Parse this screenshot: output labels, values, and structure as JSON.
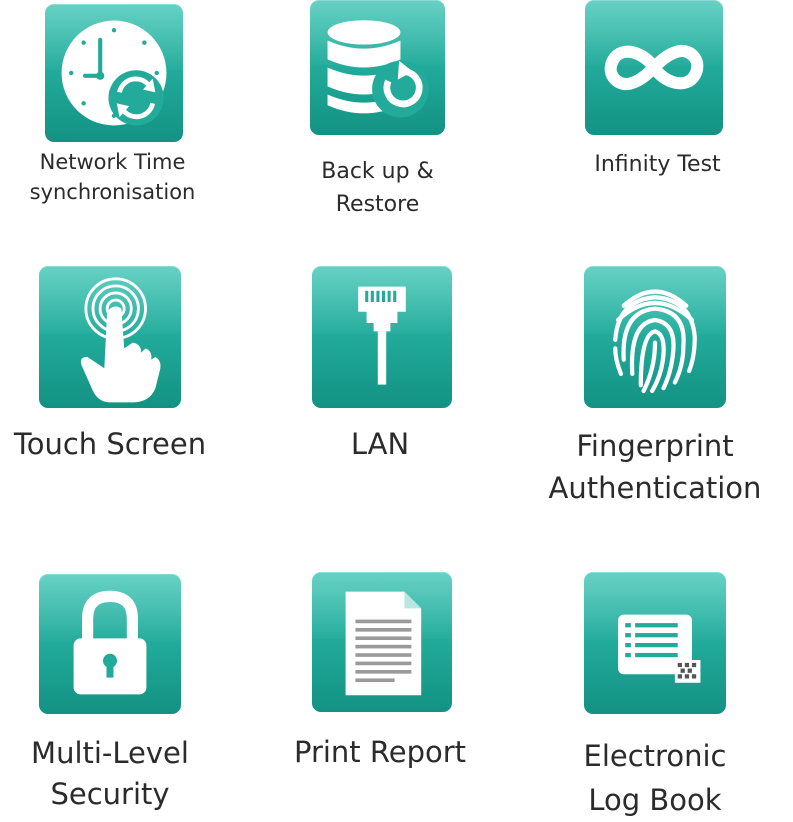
{
  "features": [
    {
      "icon": "clock-sync-icon",
      "label_lines": [
        "Network Time",
        "synchronisation"
      ]
    },
    {
      "icon": "database-restore-icon",
      "label_lines": [
        "Back up &",
        "Restore"
      ]
    },
    {
      "icon": "infinity-icon",
      "label_lines": [
        "Infinity Test"
      ]
    },
    {
      "icon": "touch-hand-icon",
      "label_lines": [
        "Touch Screen"
      ]
    },
    {
      "icon": "lan-plug-icon",
      "label_lines": [
        "LAN"
      ]
    },
    {
      "icon": "fingerprint-icon",
      "label_lines": [
        "Fingerprint",
        "Authentication"
      ]
    },
    {
      "icon": "padlock-icon",
      "label_lines": [
        "Multi-Level",
        "Security"
      ]
    },
    {
      "icon": "document-icon",
      "label_lines": [
        "Print Report"
      ]
    },
    {
      "icon": "logbook-icon",
      "label_lines": [
        "Electronic",
        "Log Book"
      ]
    }
  ],
  "colors": {
    "tile_top": "#45c7b7",
    "tile_mid": "#22ab9b",
    "tile_bottom": "#139283",
    "icon": "#ffffff",
    "label_text": "#2b2b2b"
  }
}
